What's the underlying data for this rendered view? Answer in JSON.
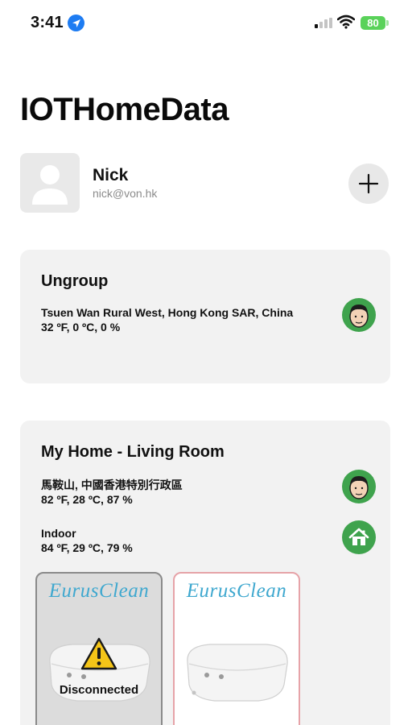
{
  "status_bar": {
    "time": "3:41",
    "battery": "80"
  },
  "app": {
    "title": "IOTHomeData"
  },
  "user": {
    "name": "Nick",
    "email": "nick@von.hk"
  },
  "groups": [
    {
      "title": "Ungroup",
      "location": "Tsuen Wan Rural West, Hong Kong SAR, China",
      "weather": "32 ºF, 0 ºC, 0 %"
    },
    {
      "title": "My Home - Living Room",
      "location": "馬鞍山, 中國香港特別行政區",
      "weather": "82 ºF, 28 ºC, 87 %",
      "indoor_label": "Indoor",
      "indoor_weather": "84 ºF, 29 ºC, 79 %",
      "devices": [
        {
          "brand": "EurusClean",
          "status": "Disconnected"
        },
        {
          "brand": "EurusClean"
        }
      ]
    }
  ],
  "colors": {
    "accent_green": "#3fa34d",
    "brand_blue": "#3fa8cf",
    "battery_green": "#5ad25a",
    "location_blue": "#1e7cf2"
  }
}
